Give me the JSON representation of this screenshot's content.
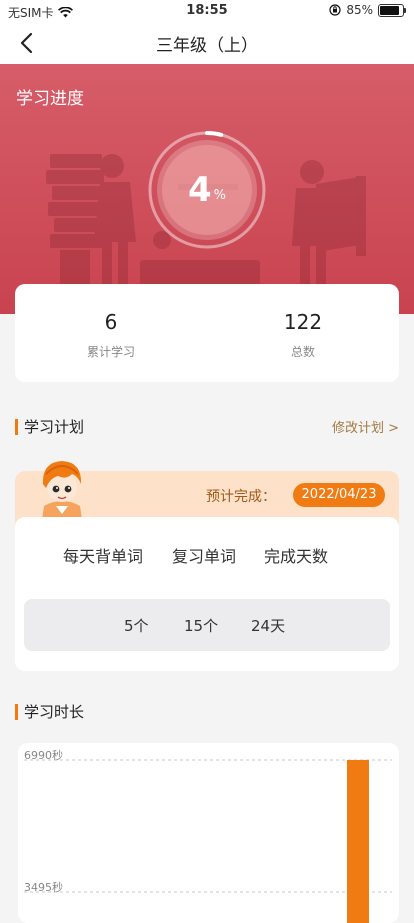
{
  "status_bar": {
    "carrier": "无SIM卡",
    "time": "18:55",
    "battery_percent": "85%",
    "battery_level": 0.85
  },
  "nav": {
    "title": "三年级（上）"
  },
  "progress": {
    "label": "学习进度",
    "value": "4",
    "unit": "%",
    "fraction": 0.04
  },
  "stats": [
    {
      "value": "6",
      "label": "累计学习"
    },
    {
      "value": "122",
      "label": "总数"
    }
  ],
  "plan": {
    "title": "学习计划",
    "edit_link": "修改计划 >",
    "estimated_label": "预计完成：",
    "estimated_date": "2022/04/23",
    "columns": [
      {
        "label": "每天背单词",
        "value": "5个"
      },
      {
        "label": "复习单词",
        "value": "15个"
      },
      {
        "label": "完成天数",
        "value": "24天"
      }
    ]
  },
  "study_time": {
    "title": "学习时长"
  },
  "chart_data": {
    "type": "bar",
    "y_ticks": [
      "6990秒",
      "3495秒"
    ],
    "y_tick_values": [
      6990,
      3495
    ],
    "values": [
      6990
    ],
    "bar_color": "#f07b12",
    "grid": true
  },
  "colors": {
    "accent": "#f07b12",
    "hero": "#c8434f",
    "link": "#a27a3d"
  }
}
